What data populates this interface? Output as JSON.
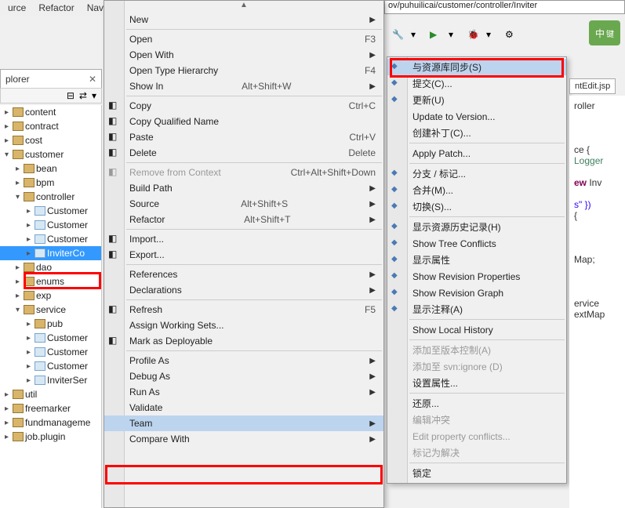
{
  "toolbar": {
    "menu1": "urce",
    "menu2": "Refactor",
    "menu3": "Nav"
  },
  "path": "ov/puhuilicai/customer/controller/Inviter",
  "ime": "中",
  "ime2": "键",
  "explorer": {
    "tab": "plorer",
    "close": "✕"
  },
  "tree": [
    {
      "d": 1,
      "a": "▸",
      "i": "pkg",
      "t": "content"
    },
    {
      "d": 1,
      "a": "▸",
      "i": "pkg",
      "t": "contract"
    },
    {
      "d": 1,
      "a": "▸",
      "i": "pkg",
      "t": "cost"
    },
    {
      "d": 1,
      "a": "▾",
      "i": "pkg",
      "t": "customer"
    },
    {
      "d": 2,
      "a": "▸",
      "i": "pkg",
      "t": "bean"
    },
    {
      "d": 2,
      "a": "▸",
      "i": "pkg",
      "t": "bpm"
    },
    {
      "d": 2,
      "a": "▾",
      "i": "pkg",
      "t": "controller"
    },
    {
      "d": 3,
      "a": "▸",
      "i": "file",
      "t": "Customer"
    },
    {
      "d": 3,
      "a": "▸",
      "i": "file",
      "t": "Customer"
    },
    {
      "d": 3,
      "a": "▸",
      "i": "file",
      "t": "Customer"
    },
    {
      "d": 3,
      "a": "▸",
      "i": "file",
      "t": "InviterCo",
      "sel": true
    },
    {
      "d": 2,
      "a": "▸",
      "i": "pkg",
      "t": "dao"
    },
    {
      "d": 2,
      "a": "▸",
      "i": "pkg",
      "t": "enums"
    },
    {
      "d": 2,
      "a": "▸",
      "i": "pkg",
      "t": "exp"
    },
    {
      "d": 2,
      "a": "▾",
      "i": "pkg",
      "t": "service"
    },
    {
      "d": 3,
      "a": "▸",
      "i": "pkg",
      "t": "pub"
    },
    {
      "d": 3,
      "a": "▸",
      "i": "file",
      "t": "Customer"
    },
    {
      "d": 3,
      "a": "▸",
      "i": "file",
      "t": "Customer"
    },
    {
      "d": 3,
      "a": "▸",
      "i": "file",
      "t": "Customer"
    },
    {
      "d": 3,
      "a": "▸",
      "i": "file",
      "t": "InviterSer"
    },
    {
      "d": 1,
      "a": "▸",
      "i": "pkg",
      "t": "util"
    },
    {
      "d": 1,
      "a": "▸",
      "i": "pkg",
      "t": "freemarker"
    },
    {
      "d": 1,
      "a": "▸",
      "i": "pkg",
      "t": "fundmanageme"
    },
    {
      "d": 1,
      "a": "▸",
      "i": "pkg",
      "t": "job.plugin"
    }
  ],
  "cm": [
    {
      "type": "item",
      "t": "New",
      "sub": true
    },
    {
      "type": "sep"
    },
    {
      "type": "item",
      "t": "Open",
      "sc": "F3"
    },
    {
      "type": "item",
      "t": "Open With",
      "sub": true
    },
    {
      "type": "item",
      "t": "Open Type Hierarchy",
      "sc": "F4"
    },
    {
      "type": "item",
      "t": "Show In",
      "sc": "Alt+Shift+W",
      "sub": true
    },
    {
      "type": "sep"
    },
    {
      "type": "item",
      "t": "Copy",
      "sc": "Ctrl+C",
      "ico": "copy"
    },
    {
      "type": "item",
      "t": "Copy Qualified Name",
      "ico": "copy"
    },
    {
      "type": "item",
      "t": "Paste",
      "sc": "Ctrl+V",
      "ico": "paste"
    },
    {
      "type": "item",
      "t": "Delete",
      "sc": "Delete",
      "ico": "delete"
    },
    {
      "type": "sep"
    },
    {
      "type": "item",
      "t": "Remove from Context",
      "sc": "Ctrl+Alt+Shift+Down",
      "dis": true,
      "ico": "minus"
    },
    {
      "type": "item",
      "t": "Build Path",
      "sub": true
    },
    {
      "type": "item",
      "t": "Source",
      "sc": "Alt+Shift+S",
      "sub": true
    },
    {
      "type": "item",
      "t": "Refactor",
      "sc": "Alt+Shift+T",
      "sub": true
    },
    {
      "type": "sep"
    },
    {
      "type": "item",
      "t": "Import...",
      "ico": "import"
    },
    {
      "type": "item",
      "t": "Export...",
      "ico": "export"
    },
    {
      "type": "sep"
    },
    {
      "type": "item",
      "t": "References",
      "sub": true
    },
    {
      "type": "item",
      "t": "Declarations",
      "sub": true
    },
    {
      "type": "sep"
    },
    {
      "type": "item",
      "t": "Refresh",
      "sc": "F5",
      "ico": "refresh"
    },
    {
      "type": "item",
      "t": "Assign Working Sets..."
    },
    {
      "type": "item",
      "t": "Mark as Deployable",
      "ico": "check"
    },
    {
      "type": "sep"
    },
    {
      "type": "item",
      "t": "Profile As",
      "sub": true
    },
    {
      "type": "item",
      "t": "Debug As",
      "sub": true
    },
    {
      "type": "item",
      "t": "Run As",
      "sub": true
    },
    {
      "type": "item",
      "t": "Validate"
    },
    {
      "type": "item",
      "t": "Team",
      "sub": true,
      "hl": true
    },
    {
      "type": "item",
      "t": "Compare With",
      "sub": true
    }
  ],
  "sm": [
    {
      "t": "与资源库同步(S)",
      "hl": true,
      "ico": "sync"
    },
    {
      "t": "提交(C)...",
      "ico": "commit"
    },
    {
      "t": "更新(U)",
      "ico": "update"
    },
    {
      "t": "Update to Version..."
    },
    {
      "t": "创建补丁(C)..."
    },
    {
      "type": "sep"
    },
    {
      "t": "Apply Patch..."
    },
    {
      "type": "sep"
    },
    {
      "t": "分支 / 标记...",
      "ico": "branch"
    },
    {
      "t": "合并(M)...",
      "ico": "merge"
    },
    {
      "t": "切换(S)...",
      "ico": "switch"
    },
    {
      "type": "sep"
    },
    {
      "t": "显示资源历史记录(H)",
      "ico": "history"
    },
    {
      "t": "Show Tree Conflicts",
      "ico": "tree"
    },
    {
      "t": "显示属性",
      "ico": "props"
    },
    {
      "t": "Show Revision Properties",
      "ico": "props"
    },
    {
      "t": "Show Revision Graph",
      "ico": "graph"
    },
    {
      "t": "显示注释(A)",
      "ico": "annotate"
    },
    {
      "type": "sep"
    },
    {
      "t": "Show Local History"
    },
    {
      "type": "sep"
    },
    {
      "t": "添加至版本控制(A)",
      "dis": true
    },
    {
      "t": "添加至 svn:ignore (D)",
      "dis": true
    },
    {
      "t": "设置属性..."
    },
    {
      "type": "sep"
    },
    {
      "t": "还原..."
    },
    {
      "t": "编辑冲突",
      "dis": true
    },
    {
      "t": "Edit property conflicts...",
      "dis": true
    },
    {
      "t": "标记为解决",
      "dis": true
    },
    {
      "type": "sep"
    },
    {
      "t": "锁定"
    }
  ],
  "editor": {
    "tab": "ntEdit.jsp"
  },
  "code": {
    "l1": "roller",
    "l2": "",
    "l3": "",
    "l4": "ce {",
    "l5": "Logger",
    "l6": "",
    "l7": "ew Inv",
    "l8": "",
    "l9": "s\" })",
    "l10": "{",
    "l11": "",
    "l12": "",
    "l13": "Map;",
    "l14": "",
    "l15": "",
    "l16": "ervice",
    "l17": "extMap"
  },
  "redboxes": {}
}
